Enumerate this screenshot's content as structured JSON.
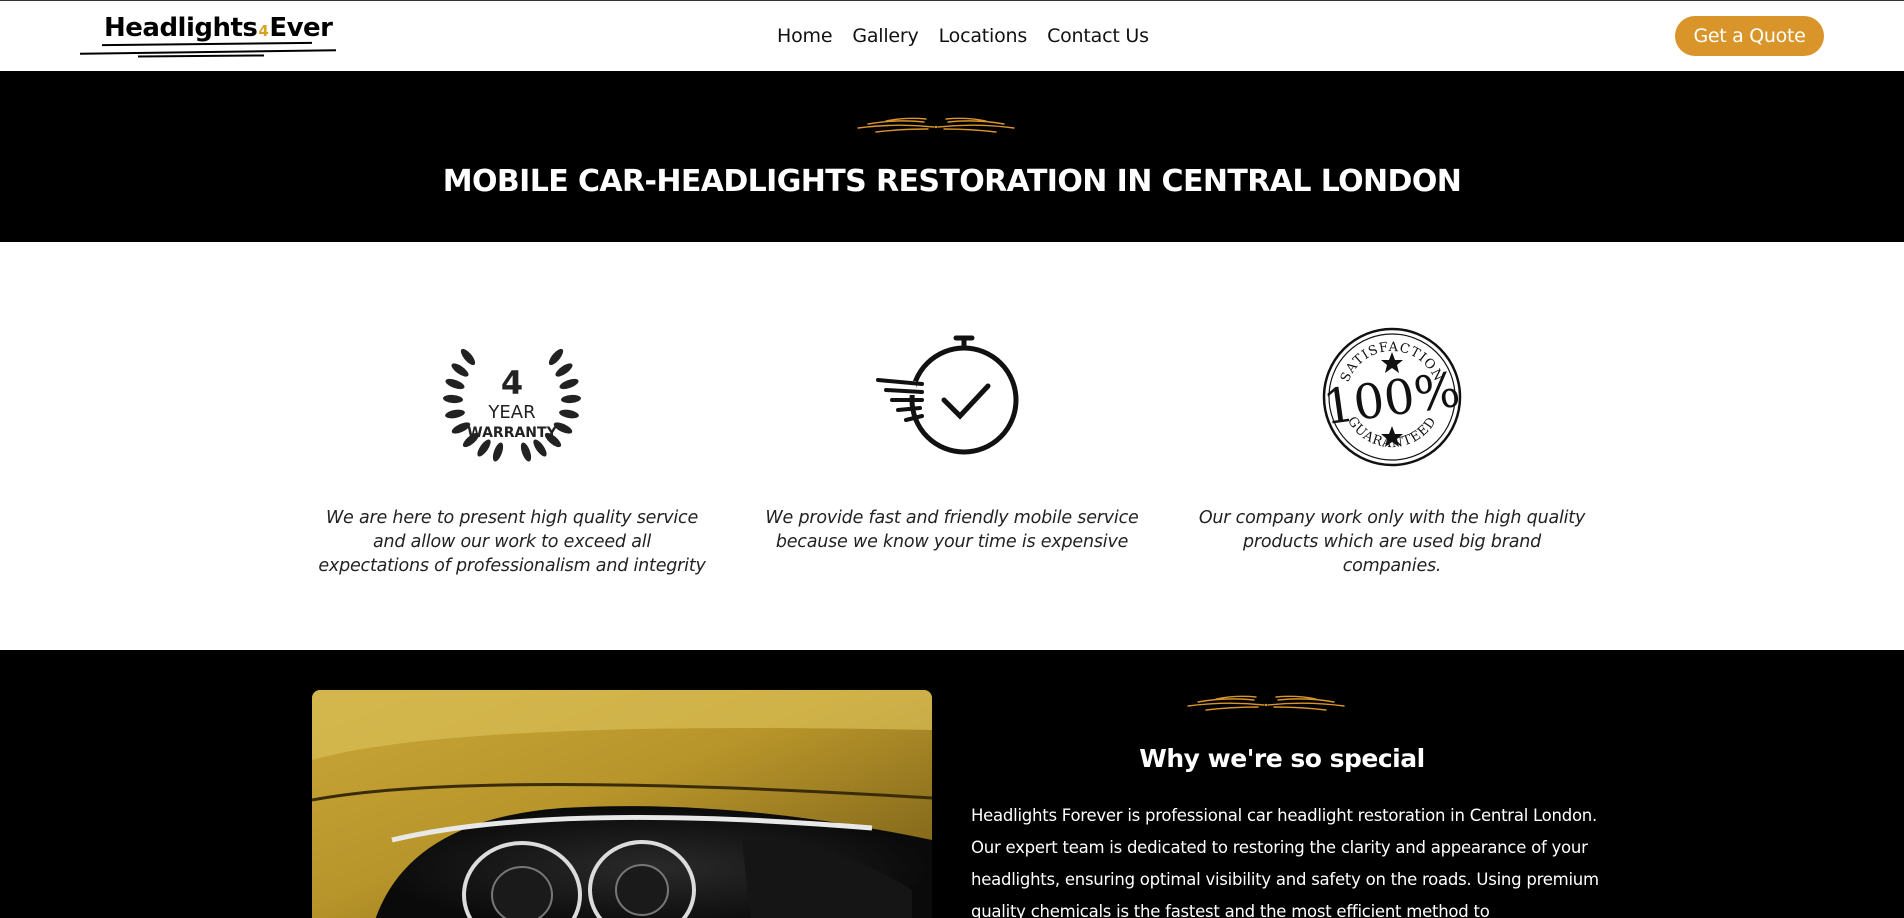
{
  "header": {
    "logo": {
      "text_main": "Headlights",
      "text_accent": "4",
      "text_end": "Ever"
    },
    "nav": [
      {
        "label": "Home"
      },
      {
        "label": "Gallery"
      },
      {
        "label": "Locations"
      },
      {
        "label": "Contact Us"
      }
    ],
    "cta_label": "Get a Quote"
  },
  "hero": {
    "title": "MOBILE CAR-HEADLIGHTS RESTORATION IN CENTRAL LONDON"
  },
  "features": [
    {
      "icon": "warranty-laurel-icon",
      "icon_text": {
        "number": "4",
        "line1": "YEAR",
        "line2": "WARRANTY"
      },
      "text": "We are here to present high quality service and allow our work to exceed all expectations of professionalism and integrity"
    },
    {
      "icon": "stopwatch-check-icon",
      "text": "We provide fast and friendly mobile service because we know your time is expensive"
    },
    {
      "icon": "satisfaction-stamp-icon",
      "icon_text": {
        "top": "SATISFACTION",
        "middle": "100%",
        "bottom": "GUARANTEED"
      },
      "text": "Our company work only with the high quality products which are used big brand companies."
    }
  ],
  "special": {
    "title": "Why we're so special",
    "text": "Headlights Forever is professional car headlight restoration in Central London. Our expert team is dedicated to restoring the clarity and appearance of your headlights, ensuring optimal visibility and safety on the roads. Using premium quality chemicals is the fastest and the most efficient method to"
  },
  "colors": {
    "accent": "#d9952a",
    "dark": "#000000",
    "light": "#ffffff"
  }
}
